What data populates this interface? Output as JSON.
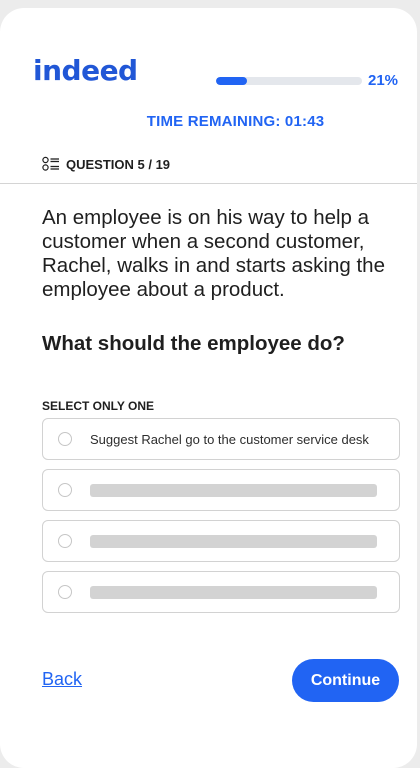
{
  "header": {
    "logo_text": "indeed",
    "progress": {
      "percent_label": "21%",
      "fraction": 0.21
    },
    "timer": "TIME REMAINING: 01:43"
  },
  "question": {
    "counter_label": "QUESTION 5 / 19",
    "counter_icon": "list-icon",
    "scenario": "An employee is on his way to help a customer when a second customer, Rachel, walks in and starts asking the employee about a product.",
    "prompt": "What should the employee do?",
    "instructions": "SELECT ONLY ONE",
    "options": [
      {
        "label": "Suggest Rachel go to the customer service desk"
      },
      {
        "label": ""
      },
      {
        "label": ""
      },
      {
        "label": ""
      }
    ]
  },
  "footer": {
    "back_label": "Back",
    "continue_label": "Continue"
  },
  "colors": {
    "accent": "#2164f3",
    "logo": "#2157d6",
    "page_bg": "#ececec",
    "text": "#1f1f1f",
    "placeholder_bar": "#d3d3d3"
  }
}
